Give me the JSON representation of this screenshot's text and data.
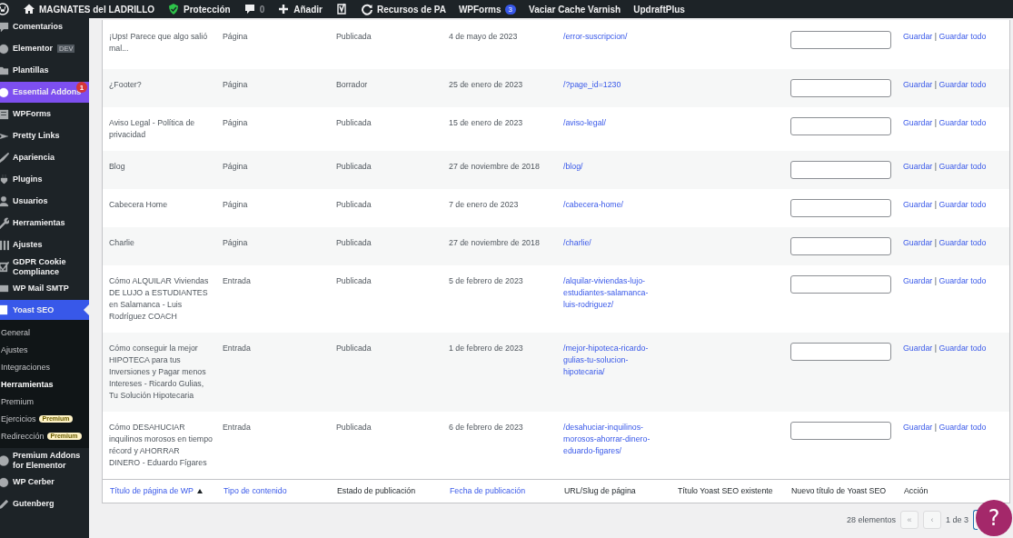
{
  "admin_bar": {
    "items": [
      {
        "kind": "icon"
      },
      {
        "kind": "link",
        "label": "MAGNATES del LADRILLO"
      },
      {
        "kind": "link",
        "label": "Protección"
      },
      {
        "kind": "link",
        "label": "0",
        "muted": true
      },
      {
        "kind": "link",
        "label": "Añadir"
      },
      {
        "kind": "icon"
      },
      {
        "kind": "link",
        "label": "Recursos de PA"
      },
      {
        "kind": "link",
        "label": "WPForms",
        "badge": "3"
      },
      {
        "kind": "link",
        "label": "Vaciar Cache Varnish"
      },
      {
        "kind": "link",
        "label": "UpdraftPlus"
      }
    ]
  },
  "sidebar": {
    "items": [
      {
        "label": "Comentarios",
        "selected": false,
        "hover": false
      },
      {
        "label": "Elementor",
        "tag": "DEV",
        "selected": false,
        "hover": false
      },
      {
        "label": "Plantillas",
        "selected": false,
        "hover": false
      },
      {
        "label": "Essential Addons",
        "badge": "1",
        "selected": false,
        "hover": true
      },
      {
        "label": "WPForms",
        "selected": false,
        "hover": false
      },
      {
        "label": "Pretty Links",
        "selected": false,
        "hover": false
      },
      {
        "label": "Apariencia",
        "selected": false,
        "hover": false
      },
      {
        "label": "Plugins",
        "selected": false,
        "hover": false
      },
      {
        "label": "Usuarios",
        "selected": false,
        "hover": false
      },
      {
        "label": "Herramientas",
        "selected": false,
        "hover": false
      },
      {
        "label": "Ajustes",
        "selected": false,
        "hover": false
      },
      {
        "label": "GDPR Cookie Compliance",
        "selected": false,
        "hover": false
      },
      {
        "label": "WP Mail SMTP",
        "selected": false,
        "hover": false
      },
      {
        "label": "Yoast SEO",
        "selected": true,
        "hover": false,
        "children": [
          {
            "label": "General",
            "selected": false
          },
          {
            "label": "Ajustes",
            "selected": false
          },
          {
            "label": "Integraciones",
            "selected": false
          },
          {
            "label": "Herramientas",
            "selected": true
          },
          {
            "label": "Premium",
            "selected": false
          },
          {
            "label": "Ejercicios",
            "selected": false,
            "badge": "Premium"
          },
          {
            "label": "Redirección",
            "selected": false,
            "badge": "Premium"
          }
        ]
      },
      {
        "label": "Premium Addons for Elementor",
        "selected": false,
        "hover": false
      },
      {
        "label": "WP Cerber",
        "selected": false,
        "hover": false
      },
      {
        "label": "Gutenberg",
        "selected": false,
        "hover": false
      }
    ]
  },
  "table": {
    "rows": [
      {
        "title": "¡Ups! Parece que algo salió mal...",
        "type": "Página",
        "status": "Publicada",
        "date": "4 de mayo de 2023",
        "url": "/error-suscripcion/",
        "actions": [
          "Guardar",
          "Guardar todo"
        ],
        "separator": "|"
      },
      {
        "title": "¿Footer?",
        "type": "Página",
        "status": "Borrador",
        "date": "25 de enero de 2023",
        "url": "/?page_id=1230",
        "actions": [
          "Guardar",
          "Guardar todo"
        ],
        "separator": "|"
      },
      {
        "title": "Aviso Legal - Política de privacidad",
        "type": "Página",
        "status": "Publicada",
        "date": "15 de enero de 2023",
        "url": "/aviso-legal/",
        "actions": [
          "Guardar",
          "Guardar todo"
        ],
        "separator": "|"
      },
      {
        "title": "Blog",
        "type": "Página",
        "status": "Publicada",
        "date": "27 de noviembre de 2018",
        "url": "/blog/",
        "actions": [
          "Guardar",
          "Guardar todo"
        ],
        "separator": "|"
      },
      {
        "title": "Cabecera Home",
        "type": "Página",
        "status": "Publicada",
        "date": "7 de enero de 2023",
        "url": "/cabecera-home/",
        "actions": [
          "Guardar",
          "Guardar todo"
        ],
        "separator": "|"
      },
      {
        "title": "Charlie",
        "type": "Página",
        "status": "Publicada",
        "date": "27 de noviembre de 2018",
        "url": "/charlie/",
        "actions": [
          "Guardar",
          "Guardar todo"
        ],
        "separator": "|"
      },
      {
        "title": "Cómo ALQUILAR Viviendas DE LUJO a ESTUDIANTES en Salamanca - Luis Rodríguez COACH",
        "type": "Entrada",
        "status": "Publicada",
        "date": "5 de febrero de 2023",
        "url": "/alquilar-viviendas-lujo-estudiantes-salamanca-luis-rodriguez/",
        "actions": [
          "Guardar",
          "Guardar todo"
        ],
        "separator": "|"
      },
      {
        "title": "Cómo conseguir la mejor HIPOTECA para tus Inversiones y Pagar menos Intereses - Ricardo Gulias, Tu Solución Hipotecaria",
        "type": "Entrada",
        "status": "Publicada",
        "date": "1 de febrero de 2023",
        "url": "/mejor-hipoteca-ricardo-gulias-tu-solucion-hipotecaria/",
        "actions": [
          "Guardar",
          "Guardar todo"
        ],
        "separator": "|"
      },
      {
        "title": "Cómo DESAHUCIAR inquilinos morosos en tiempo récord y AHORRAR DINERO - Eduardo Fígares",
        "type": "Entrada",
        "status": "Publicada",
        "date": "6 de febrero de 2023",
        "url": "/desahuciar-inquilinos-morosos-ahorrar-dinero-eduardo-figares/",
        "actions": [
          "Guardar",
          "Guardar todo"
        ],
        "separator": "|"
      }
    ],
    "columns": [
      {
        "label": "Título de página de WP",
        "sortable": true,
        "sorted": true
      },
      {
        "label": "Tipo de contenido",
        "sortable": true,
        "sorted": false
      },
      {
        "label": "Estado de publicación",
        "sortable": false,
        "sorted": false
      },
      {
        "label": "Fecha de publicación",
        "sortable": true,
        "sorted": false
      },
      {
        "label": "URL/Slug de página",
        "sortable": false,
        "sorted": false
      },
      {
        "label": "Título Yoast SEO existente",
        "sortable": false,
        "sorted": false
      },
      {
        "label": "Nuevo título de Yoast SEO",
        "sortable": false,
        "sorted": false
      },
      {
        "label": "Acción",
        "sortable": false,
        "sorted": false
      }
    ]
  },
  "pagination": {
    "count": "28 elementos",
    "buttons": [
      {
        "label": "«",
        "disabled": true
      },
      {
        "label": "‹",
        "disabled": true
      }
    ],
    "page": "1 de 3"
  },
  "help_button": {
    "label": "?"
  }
}
